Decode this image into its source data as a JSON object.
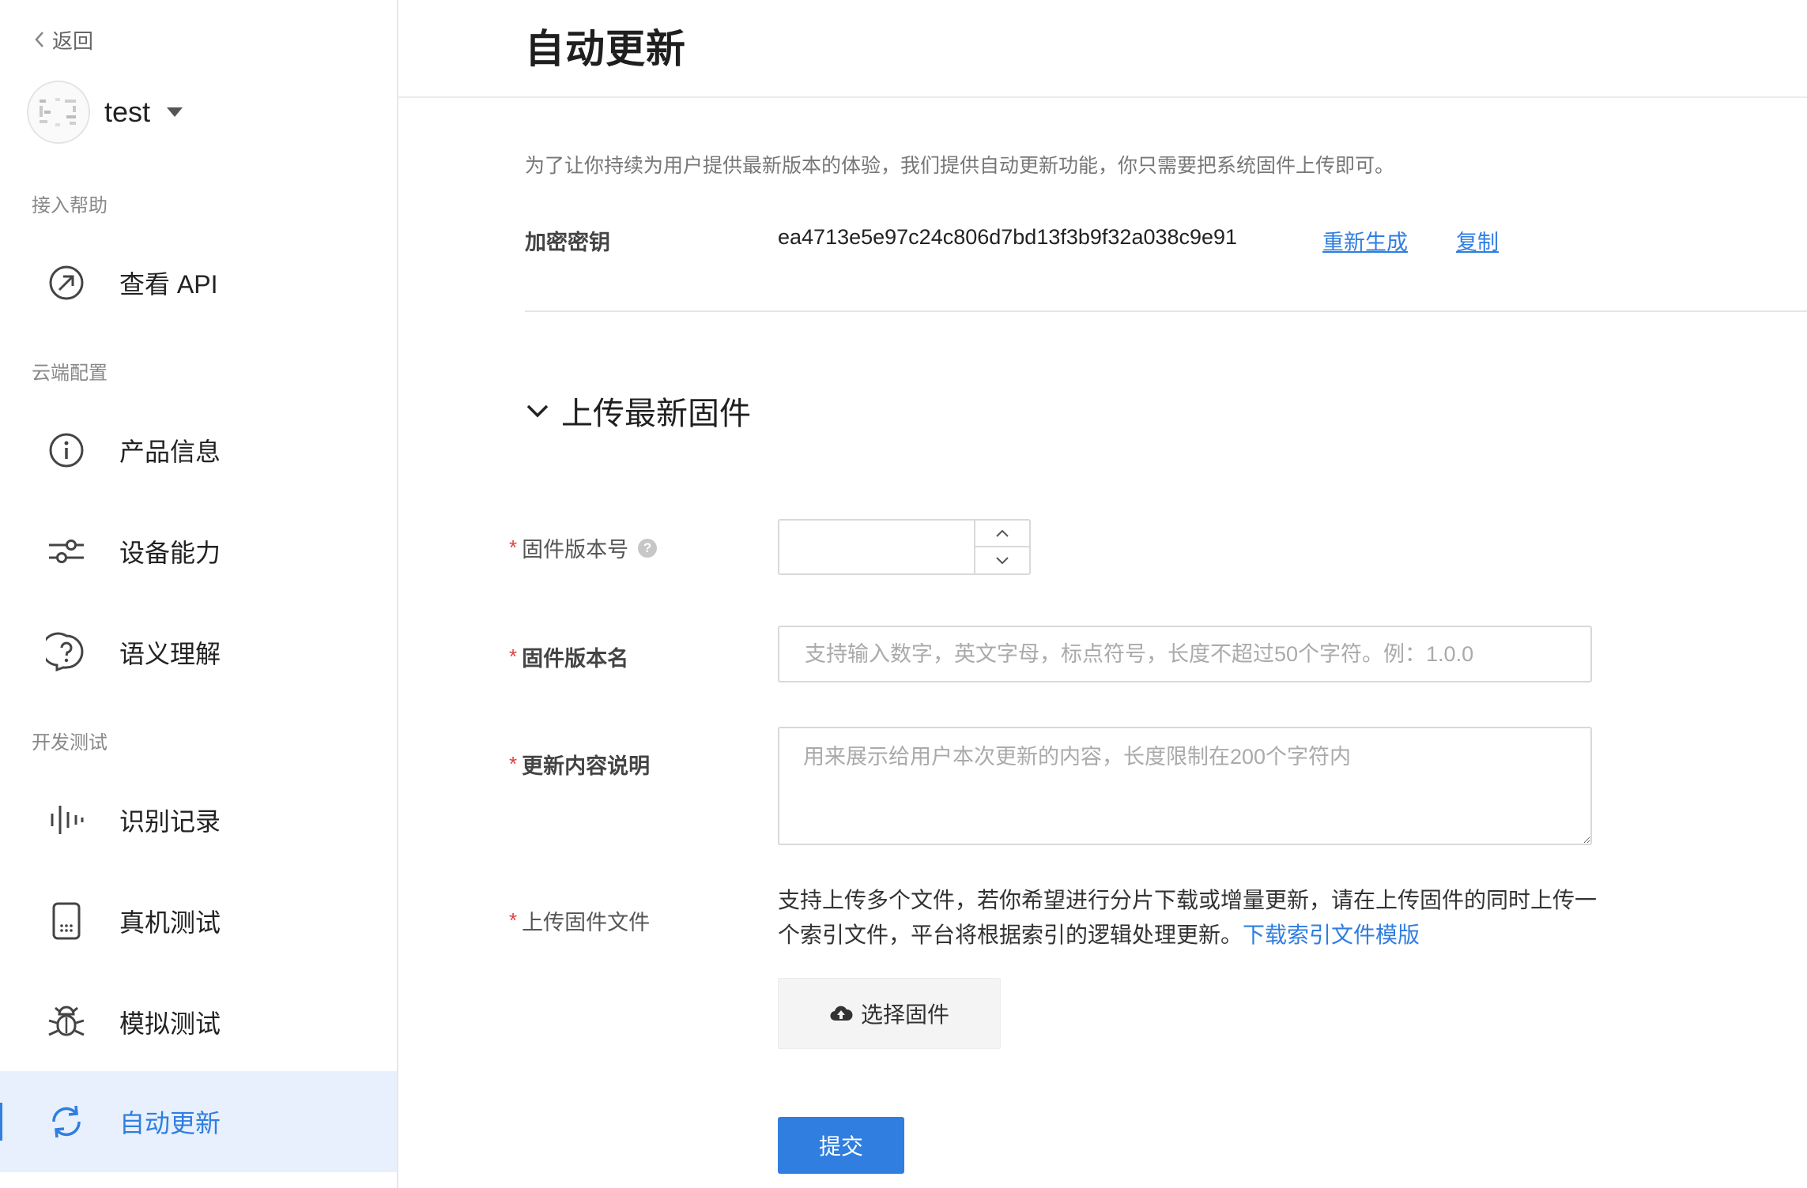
{
  "sidebar": {
    "back_label": "返回",
    "profile": {
      "name": "test"
    },
    "sections": [
      {
        "label": "接入帮助",
        "items": [
          {
            "label": "查看 API",
            "icon": "arrow-circle-icon"
          }
        ]
      },
      {
        "label": "云端配置",
        "items": [
          {
            "label": "产品信息",
            "icon": "info-icon"
          },
          {
            "label": "设备能力",
            "icon": "sliders-icon"
          },
          {
            "label": "语义理解",
            "icon": "question-bubble-icon"
          }
        ]
      },
      {
        "label": "开发测试",
        "items": [
          {
            "label": "识别记录",
            "icon": "voice-wave-icon"
          },
          {
            "label": "真机测试",
            "icon": "device-icon"
          },
          {
            "label": "模拟测试",
            "icon": "bug-icon"
          },
          {
            "label": "自动更新",
            "icon": "refresh-icon",
            "active": true
          }
        ]
      }
    ]
  },
  "main": {
    "title": "自动更新",
    "intro": "为了让你持续为用户提供最新版本的体验，我们提供自动更新功能，你只需要把系统固件上传即可。",
    "key": {
      "label": "加密密钥",
      "value": "ea4713e5e97c24c806d7bd13f3b9f32a038c9e91",
      "regenerate_label": "重新生成",
      "copy_label": "复制"
    },
    "section_title": "上传最新固件",
    "form": {
      "required_mark": "*",
      "version_code": {
        "label": "固件版本号",
        "value": ""
      },
      "version_name": {
        "label": "固件版本名",
        "placeholder": "支持输入数字，英文字母，标点符号，长度不超过50个字符。例：1.0.0",
        "value": ""
      },
      "changelog": {
        "label": "更新内容说明",
        "placeholder": "用来展示给用户本次更新的内容，长度限制在200个字符内",
        "value": ""
      },
      "upload": {
        "label": "上传固件文件",
        "description": "支持上传多个文件，若你希望进行分片下载或增量更新，请在上传固件的同时上传一个索引文件，平台将根据索引的逻辑处理更新。",
        "download_link": "下载索引文件模版",
        "choose_label": "选择固件"
      },
      "submit_label": "提交"
    }
  },
  "colors": {
    "accent": "#2f7ee0",
    "active_bg": "#e7f0fc",
    "required": "#e0423b"
  }
}
